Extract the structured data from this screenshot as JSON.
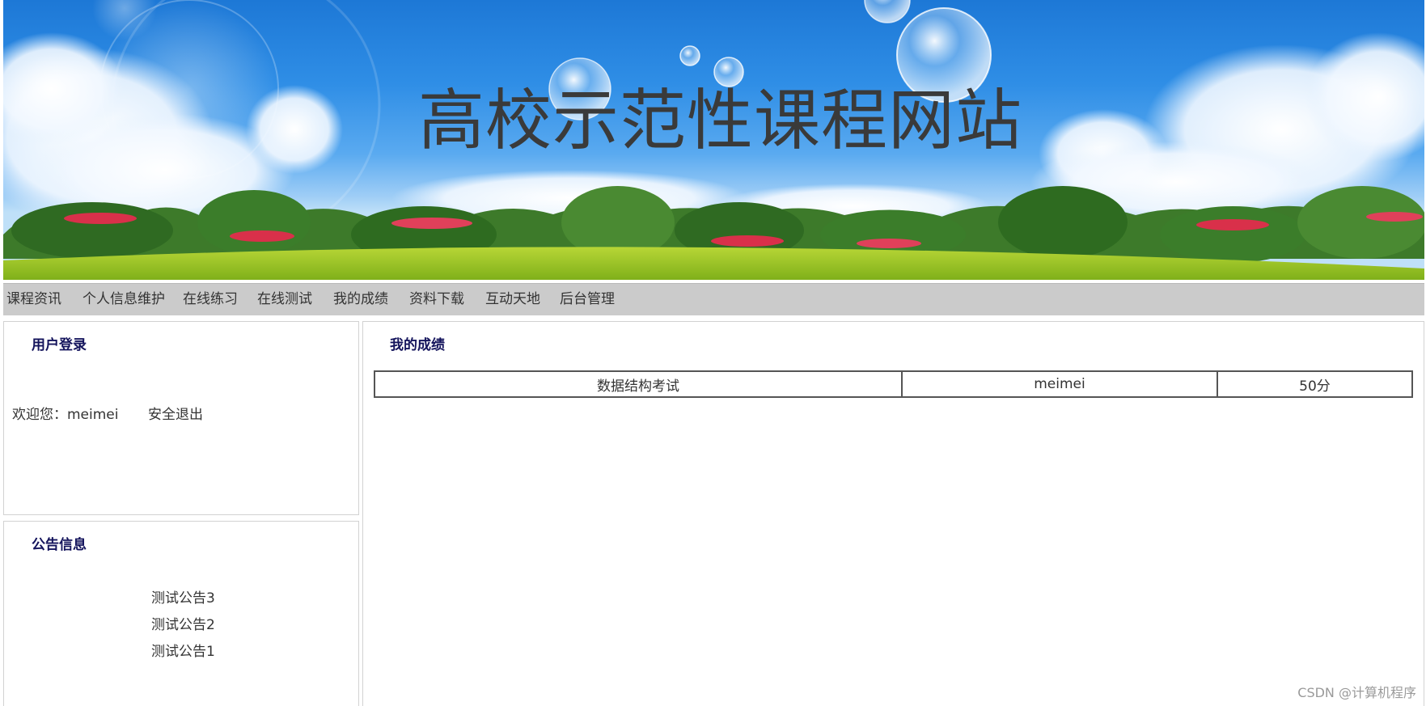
{
  "header": {
    "title": "高校示范性课程网站"
  },
  "nav": {
    "items": [
      {
        "label": "课程资讯"
      },
      {
        "label": "个人信息维护"
      },
      {
        "label": "在线练习"
      },
      {
        "label": "在线测试"
      },
      {
        "label": "我的成绩"
      },
      {
        "label": "资料下载"
      },
      {
        "label": "互动天地"
      },
      {
        "label": "后台管理"
      }
    ]
  },
  "login": {
    "title": "用户登录",
    "welcome": "欢迎您：meimei",
    "logout": "安全退出"
  },
  "notices": {
    "title": "公告信息",
    "items": [
      "测试公告3",
      "测试公告2",
      "测试公告1"
    ]
  },
  "grades": {
    "title": "我的成绩",
    "rows": [
      {
        "exam": "数据结构考试",
        "user": "meimei",
        "score": "50分"
      }
    ]
  },
  "watermark": "CSDN @计算机程序",
  "colors": {
    "nav_bg": "#cbcbcb",
    "panel_title": "#14145c",
    "sky": "#2f8ee6",
    "grass": "#9cc51e"
  }
}
